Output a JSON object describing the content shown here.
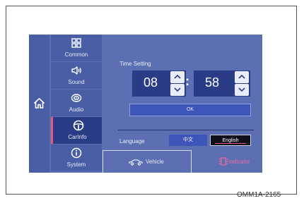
{
  "sidebar": {
    "items": [
      {
        "label": "Common",
        "icon": "grid-icon"
      },
      {
        "label": "Sound",
        "icon": "speaker-icon"
      },
      {
        "label": "Audio",
        "icon": "disc-icon"
      },
      {
        "label": "CarInfo",
        "icon": "steering-wheel-icon"
      },
      {
        "label": "System",
        "icon": "info-icon"
      }
    ],
    "active_index": 3
  },
  "time_setting": {
    "label": "Time Setting",
    "hours": "08",
    "minutes": "58",
    "separator": ":",
    "ok_label": "OK"
  },
  "language": {
    "label": "Language",
    "options": [
      "中文",
      "English"
    ],
    "selected": "English"
  },
  "tabs": {
    "vehicle_label": "Vehicle",
    "indicator_label": "Indicator"
  },
  "caption": "OMM1A-2165",
  "colors": {
    "screen_bg": "#5b6fb2",
    "dark_panel": "#2a3c86",
    "accent_pink": "#e05a7a",
    "indicator_pink": "#f06aa0"
  }
}
